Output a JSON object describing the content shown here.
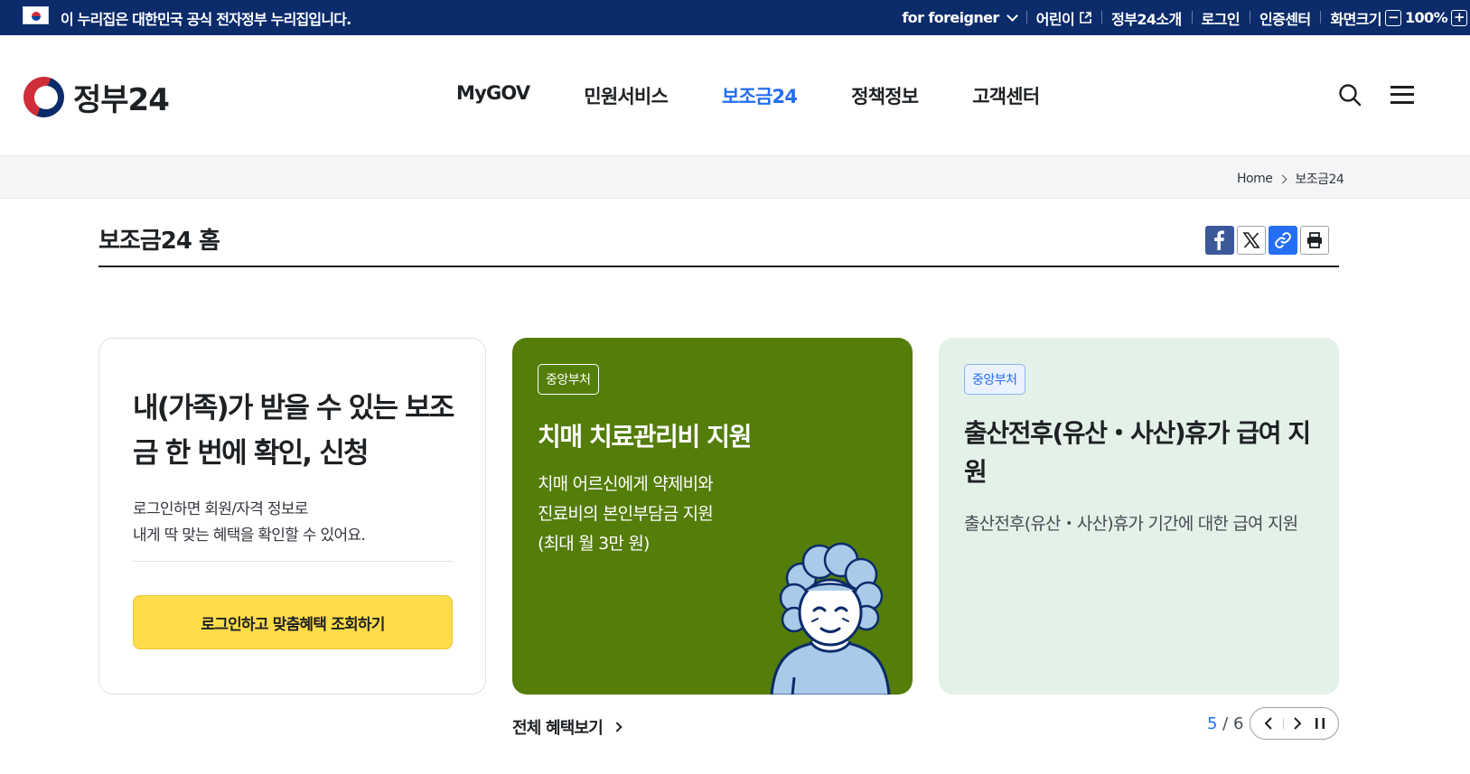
{
  "banner": {
    "official_text": "이 누리집은 대한민국 공식 전자정부 누리집입니다.",
    "flag_icon": "taegukgi-flag-icon"
  },
  "util_menu": {
    "foreigner": "for foreigner",
    "kids": "어린이",
    "about": "정부24소개",
    "login": "로그인",
    "cert": "인증센터",
    "screen_size": "화면크기",
    "zoom_minus": "−",
    "zoom_value": "100%",
    "zoom_plus": "+"
  },
  "header": {
    "logo_text": "정부24",
    "nav": [
      "MyGOV",
      "민원서비스",
      "보조금24",
      "정책정보",
      "고객센터"
    ],
    "active_index": 2
  },
  "breadcrumb": {
    "home": "Home",
    "current": "보조금24"
  },
  "page": {
    "title": "보조금24 홈"
  },
  "card_intro": {
    "headline": "내(가족)가 받을 수 있는 보조금 한 번에 확인, 신청",
    "desc_line1": "로그인하면 회원/자격 정보로",
    "desc_line2": "내게 딱 맞는 혜택을 확인할 수 있어요.",
    "button": "로그인하고 맞춤혜택 조회하기"
  },
  "card_green": {
    "badge": "중앙부처",
    "title": "치매 치료관리비 지원",
    "desc_line1": "치매 어르신에게 약제비와",
    "desc_line2": "진료비의 본인부담금 지원",
    "desc_line3": "(최대 월 3만 원)",
    "bg_color": "#547d0a"
  },
  "card_mint": {
    "badge": "중앙부처",
    "title": "출산전후(유산・사산)휴가 급여 지원",
    "desc": "출산전후(유산・사산)휴가 기간에 대한 급여 지원",
    "bg_color": "#e3f1e8"
  },
  "footer_row": {
    "all_benefits": "전체 혜택보기",
    "page_current": "5",
    "page_sep": " / ",
    "page_total": "6"
  },
  "colors": {
    "brand_navy": "#0b2b6b",
    "accent_blue": "#256ef4",
    "cta_yellow": "#ffdc4a"
  }
}
